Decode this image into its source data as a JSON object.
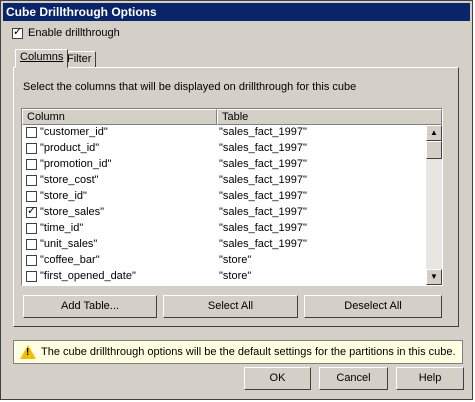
{
  "window": {
    "title": "Cube Drillthrough Options"
  },
  "enable": {
    "label": "Enable drillthrough",
    "checked": true
  },
  "tabs": [
    {
      "label": "Columns"
    },
    {
      "label": "Filter"
    }
  ],
  "instructions": "Select the columns that will be displayed on drillthrough for this cube",
  "list": {
    "headers": {
      "column": "Column",
      "table": "Table"
    },
    "rows": [
      {
        "column": "\"customer_id\"",
        "table": "\"sales_fact_1997\"",
        "checked": false
      },
      {
        "column": "\"product_id\"",
        "table": "\"sales_fact_1997\"",
        "checked": false
      },
      {
        "column": "\"promotion_id\"",
        "table": "\"sales_fact_1997\"",
        "checked": false
      },
      {
        "column": "\"store_cost\"",
        "table": "\"sales_fact_1997\"",
        "checked": false
      },
      {
        "column": "\"store_id\"",
        "table": "\"sales_fact_1997\"",
        "checked": false
      },
      {
        "column": "\"store_sales\"",
        "table": "\"sales_fact_1997\"",
        "checked": true
      },
      {
        "column": "\"time_id\"",
        "table": "\"sales_fact_1997\"",
        "checked": false
      },
      {
        "column": "\"unit_sales\"",
        "table": "\"sales_fact_1997\"",
        "checked": false
      },
      {
        "column": "\"coffee_bar\"",
        "table": "\"store\"",
        "checked": false
      },
      {
        "column": "\"first_opened_date\"",
        "table": "\"store\"",
        "checked": false
      }
    ]
  },
  "buttons": {
    "add_table": "Add Table...",
    "select_all": "Select All",
    "deselect_all": "Deselect All",
    "ok": "OK",
    "cancel": "Cancel",
    "help": "Help"
  },
  "info": {
    "icon": "warning-icon",
    "text": "The cube drillthrough options will be the default settings for the partitions in this cube."
  }
}
